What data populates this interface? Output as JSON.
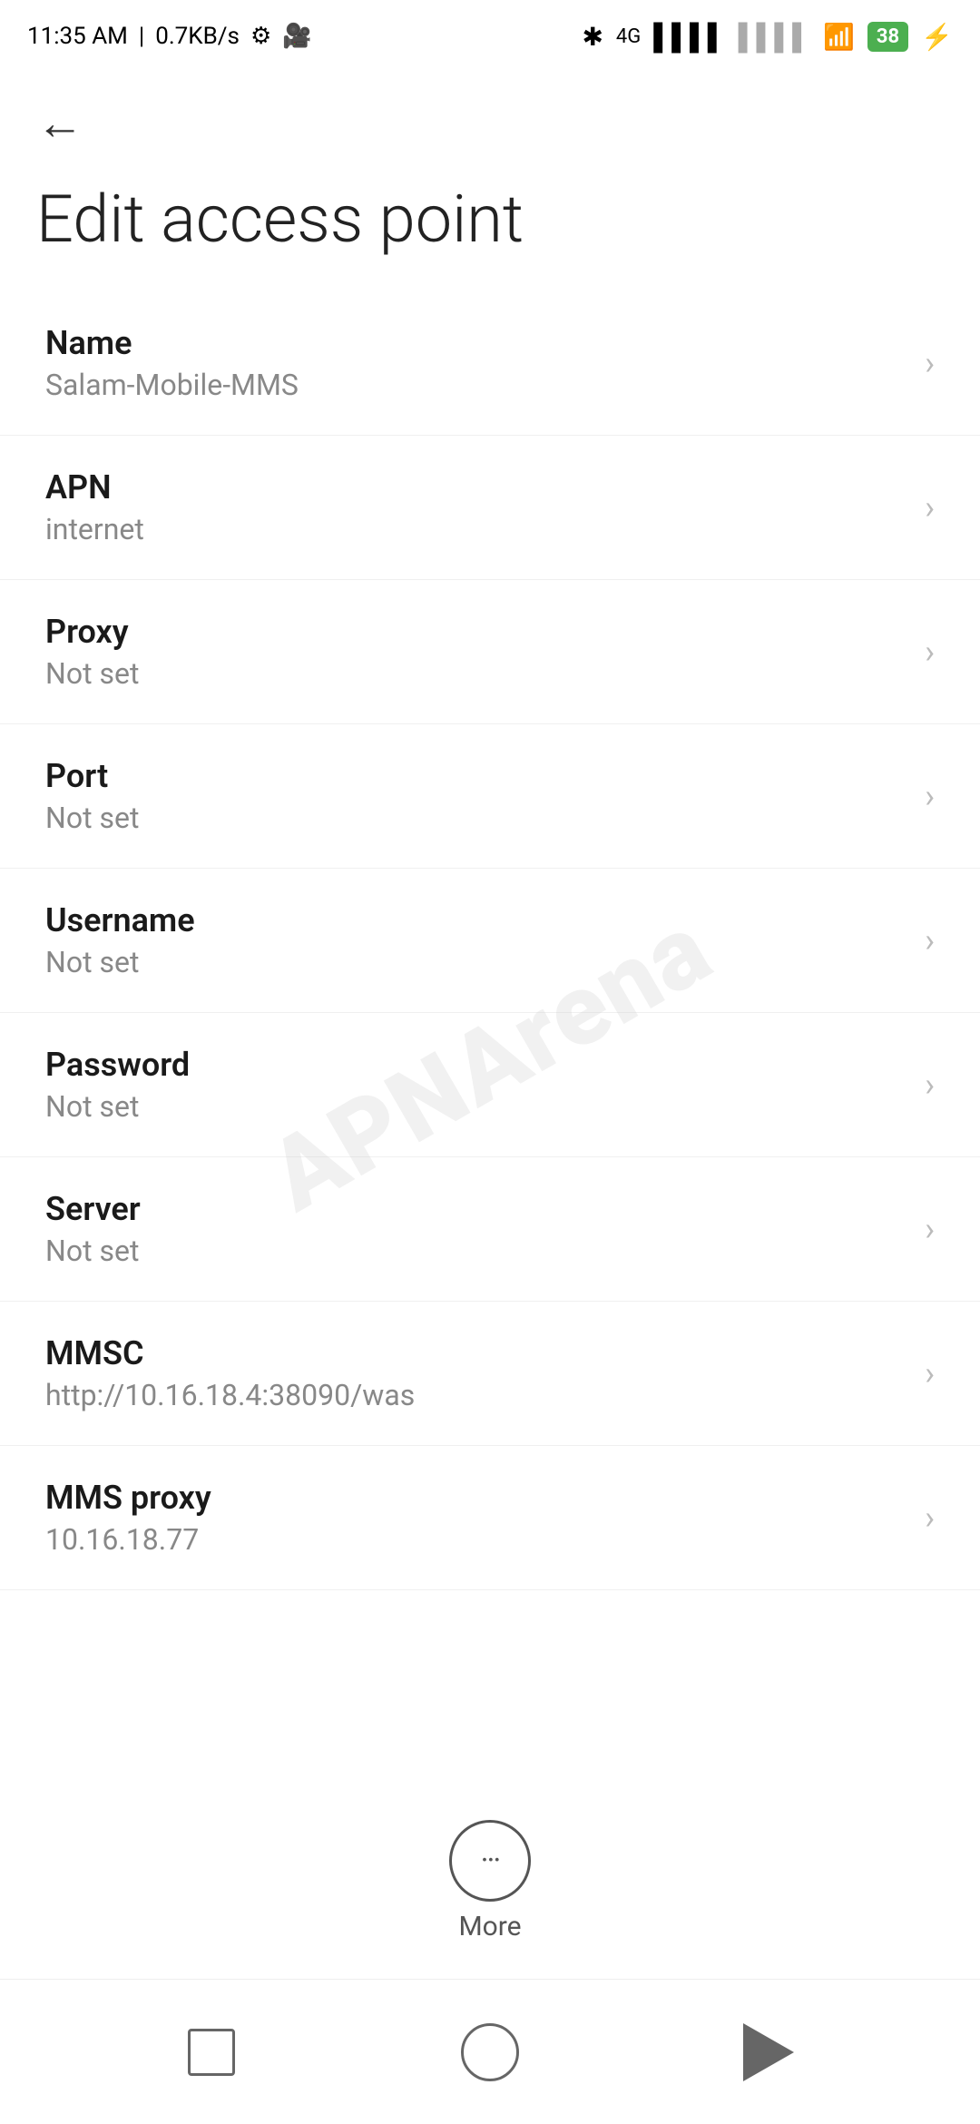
{
  "statusBar": {
    "time": "11:35 AM",
    "speed": "0.7KB/s",
    "batteryPercent": "38"
  },
  "nav": {
    "backLabel": "←"
  },
  "pageTitle": "Edit access point",
  "settingsItems": [
    {
      "id": "name",
      "label": "Name",
      "value": "Salam-Mobile-MMS"
    },
    {
      "id": "apn",
      "label": "APN",
      "value": "internet"
    },
    {
      "id": "proxy",
      "label": "Proxy",
      "value": "Not set"
    },
    {
      "id": "port",
      "label": "Port",
      "value": "Not set"
    },
    {
      "id": "username",
      "label": "Username",
      "value": "Not set"
    },
    {
      "id": "password",
      "label": "Password",
      "value": "Not set"
    },
    {
      "id": "server",
      "label": "Server",
      "value": "Not set"
    },
    {
      "id": "mmsc",
      "label": "MMSC",
      "value": "http://10.16.18.4:38090/was"
    },
    {
      "id": "mms-proxy",
      "label": "MMS proxy",
      "value": "10.16.18.77"
    }
  ],
  "more": {
    "label": "More"
  },
  "watermark": "APNArena"
}
